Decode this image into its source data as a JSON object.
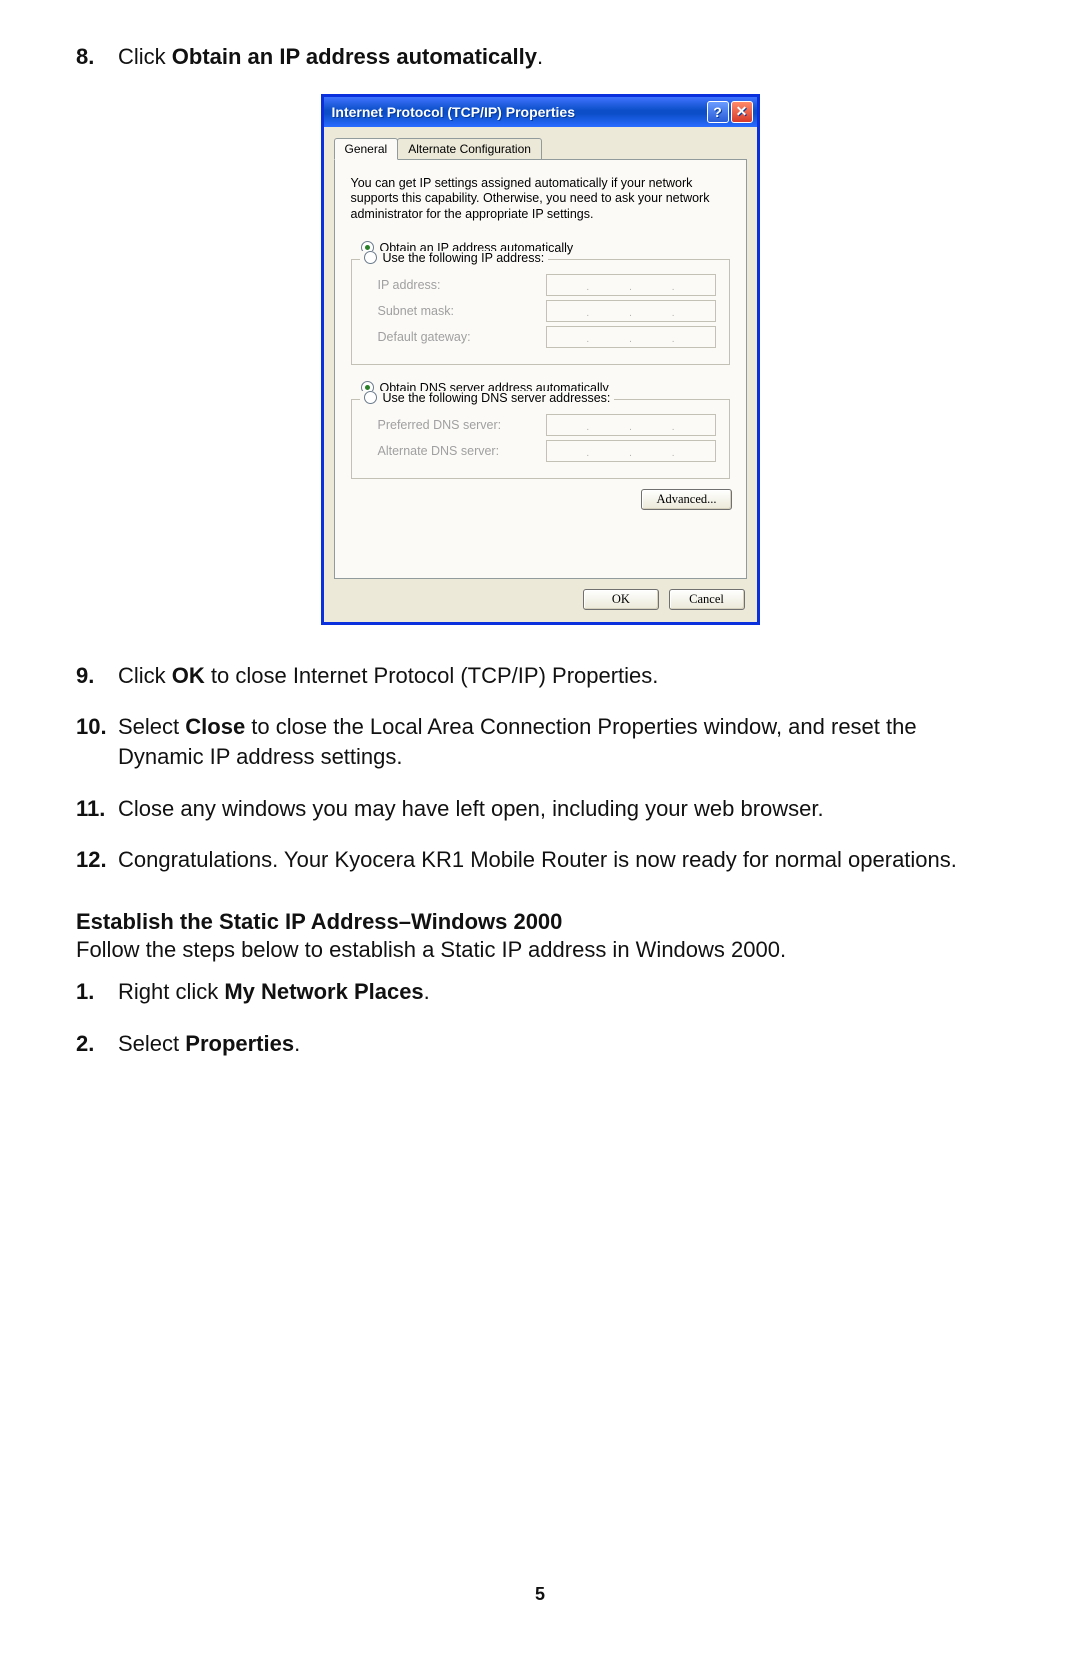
{
  "page_number": "5",
  "step8": {
    "num": "8.",
    "prefix": "Click ",
    "bold": "Obtain an IP address automatically",
    "suffix": "."
  },
  "dialog": {
    "title": "Internet Protocol (TCP/IP) Properties",
    "help_btn": "?",
    "close_btn": "✕",
    "tabs": {
      "general": "General",
      "alt": "Alternate Configuration"
    },
    "descr": "You can get IP settings assigned automatically if your network supports this capability. Otherwise, you need to ask your network administrator for the appropriate IP settings.",
    "radio_auto_ip": "Obtain an IP address automatically",
    "radio_use_ip": "Use the following IP address:",
    "lbl_ip": "IP address:",
    "lbl_mask": "Subnet mask:",
    "lbl_gw": "Default gateway:",
    "radio_auto_dns": "Obtain DNS server address automatically",
    "radio_use_dns": "Use the following DNS server addresses:",
    "lbl_pref_dns": "Preferred DNS server:",
    "lbl_alt_dns": "Alternate DNS server:",
    "advanced": "Advanced...",
    "ok": "OK",
    "cancel": "Cancel"
  },
  "step9": {
    "num": "9.",
    "p1": "Click ",
    "b1": "OK",
    "p2": " to close Internet Protocol (TCP/IP) Properties."
  },
  "step10": {
    "num": "10.",
    "p1": "Select ",
    "b1": "Close",
    "p2": " to close the Local Area Connection Properties window, and reset the Dynamic IP address settings."
  },
  "step11": {
    "num": "11.",
    "text": "Close any windows you may have left open, including your web browser."
  },
  "step12": {
    "num": "12.",
    "text": "Congratulations. Your Kyocera KR1 Mobile Router is now ready for normal operations."
  },
  "section_heading": "Establish the Static IP Address–Windows 2000",
  "section_intro": "Follow the steps below to establish a Static IP address in Windows 2000.",
  "sub1": {
    "num": "1.",
    "p1": "Right click ",
    "b1": "My Network Places",
    "p2": "."
  },
  "sub2": {
    "num": "2.",
    "p1": "Select ",
    "b1": "Properties",
    "p2": "."
  }
}
